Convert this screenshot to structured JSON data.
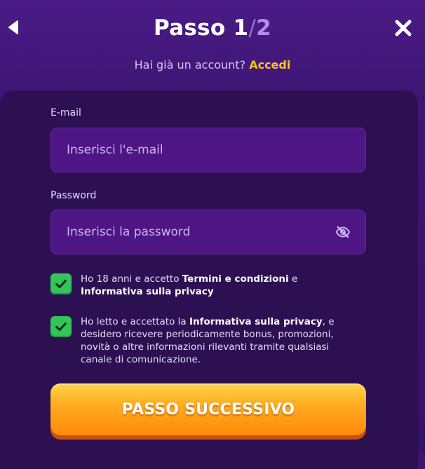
{
  "header": {
    "title_prefix": "Passo ",
    "step_current": "1",
    "step_separator": "/",
    "step_total": "2",
    "back_icon": "chevron-left-icon",
    "close_icon": "close-icon"
  },
  "login": {
    "question": "Hai già un account?",
    "link": "Accedi"
  },
  "form": {
    "email_label": "E-mail",
    "email_placeholder": "Inserisci l'e-mail",
    "password_label": "Password",
    "password_placeholder": "Inserisci la password",
    "password_toggle_icon": "eye-off-icon"
  },
  "consents": [
    {
      "checked": true,
      "text_1": "Ho 18 anni e accetto ",
      "bold_1": "Termini e condizioni",
      "text_2": " e ",
      "bold_2": "Informativa sulla privacy"
    },
    {
      "checked": true,
      "text_1": "Ho letto e accettato la ",
      "bold_1": "Informativa sulla privacy",
      "text_2": ", e desidero ricevere periodicamente bonus, promozioni, novità o altre informazioni rilevanti tramite qualsiasi canale di comunicazione."
    }
  ],
  "cta": {
    "label": "PASSO SUCCESSIVO"
  },
  "colors": {
    "background": "#3a1670",
    "panel": "#2c1052",
    "input": "#4d1684",
    "accent_link": "#ffc21a",
    "checkbox": "#33c45a",
    "cta": "#ff9a12"
  }
}
